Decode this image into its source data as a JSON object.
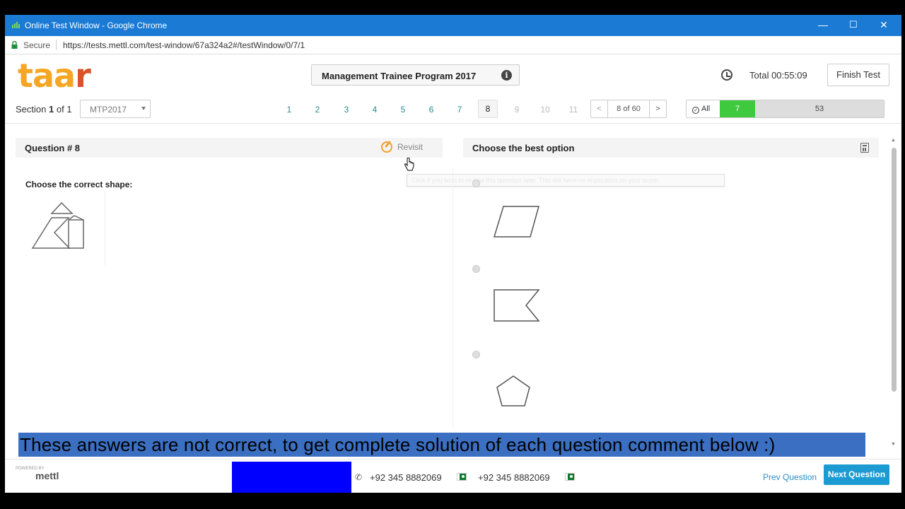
{
  "window": {
    "title": "Online Test Window - Google Chrome",
    "minimize": "—",
    "maximize": "☐",
    "close": "✕"
  },
  "address": {
    "secure_label": "Secure",
    "url": "https://tests.mettl.com/test-window/67a324a2#/testWindow/0/7/1"
  },
  "header": {
    "logo_main": "taa",
    "logo_accent": "r",
    "test_name": "Management Trainee Program 2017",
    "info_glyph": "i",
    "timer": "Total 00:55:09",
    "finish_label": "Finish Test"
  },
  "section": {
    "label": "Section",
    "number": "1",
    "of_label": "of 1",
    "selected": "MTP2017"
  },
  "questions_nav": [
    {
      "label": "1",
      "state": "answered"
    },
    {
      "label": "2",
      "state": "answered"
    },
    {
      "label": "3",
      "state": "answered"
    },
    {
      "label": "4",
      "state": "answered"
    },
    {
      "label": "5",
      "state": "answered"
    },
    {
      "label": "6",
      "state": "answered"
    },
    {
      "label": "7",
      "state": "answered"
    },
    {
      "label": "8",
      "state": "current"
    },
    {
      "label": "9",
      "state": "disabled"
    },
    {
      "label": "10",
      "state": "disabled"
    },
    {
      "label": "11",
      "state": "disabled"
    }
  ],
  "pager": {
    "prev": "<",
    "count": "8 of 60",
    "next": ">"
  },
  "filter": {
    "all_label": "All",
    "answered_count": "7",
    "unanswered_count": "53",
    "answered_color": "#3ec93e"
  },
  "question": {
    "title": "Question # 8",
    "revisit_label": "Revisit",
    "text": "Choose the correct shape:"
  },
  "options_panel": {
    "title": "Choose the best option",
    "tooltip": "Click if you wish to review this question later. This will have no implication on your score."
  },
  "caption": "These answers are not correct, to get complete solution of each question comment below :)",
  "footer": {
    "powered_by": "POWERED BY",
    "brand": "mettl",
    "phone1": "+92 345 8882069",
    "phone2": "+92 345 8882069",
    "prev_label": "Prev Question",
    "next_label": "Next Question",
    "accent_color": "#1b9bd1"
  }
}
